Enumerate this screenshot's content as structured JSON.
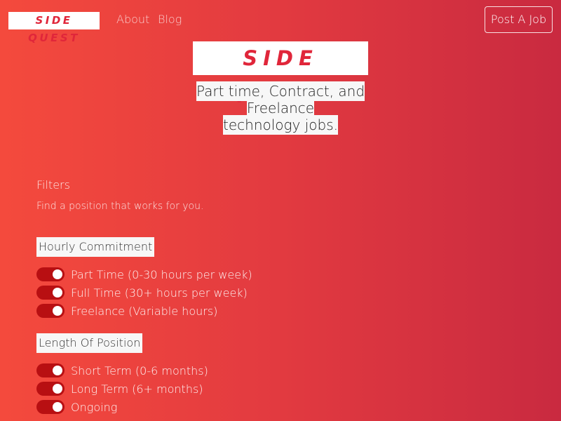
{
  "navbar": {
    "brand": "SIDE QUEST",
    "links": [
      "About",
      "Blog"
    ],
    "cta": "Post A Job"
  },
  "hero": {
    "logo": "SIDE QUEST",
    "tagline_line1": "Part time, Contract, and Freelance",
    "tagline_line2": "technology jobs."
  },
  "filters": {
    "title": "Filters",
    "subtitle": "Find a position that works for you.",
    "groups": [
      {
        "label": "Hourly Commitment",
        "options": [
          {
            "label": "Part Time (0-30 hours per week)",
            "checked": true
          },
          {
            "label": "Full Time (30+ hours per week)",
            "checked": true
          },
          {
            "label": "Freelance (Variable hours)",
            "checked": true
          }
        ]
      },
      {
        "label": "Length Of Position",
        "options": [
          {
            "label": "Short Term (0-6 months)",
            "checked": true
          },
          {
            "label": "Long Term (6+ months)",
            "checked": true
          },
          {
            "label": "Ongoing",
            "checked": true
          }
        ]
      }
    ]
  },
  "colors": {
    "accent": "#e0263a",
    "toggle_on": "#b80f12",
    "background_start": "#f44a3d",
    "background_end": "#c92a40"
  }
}
